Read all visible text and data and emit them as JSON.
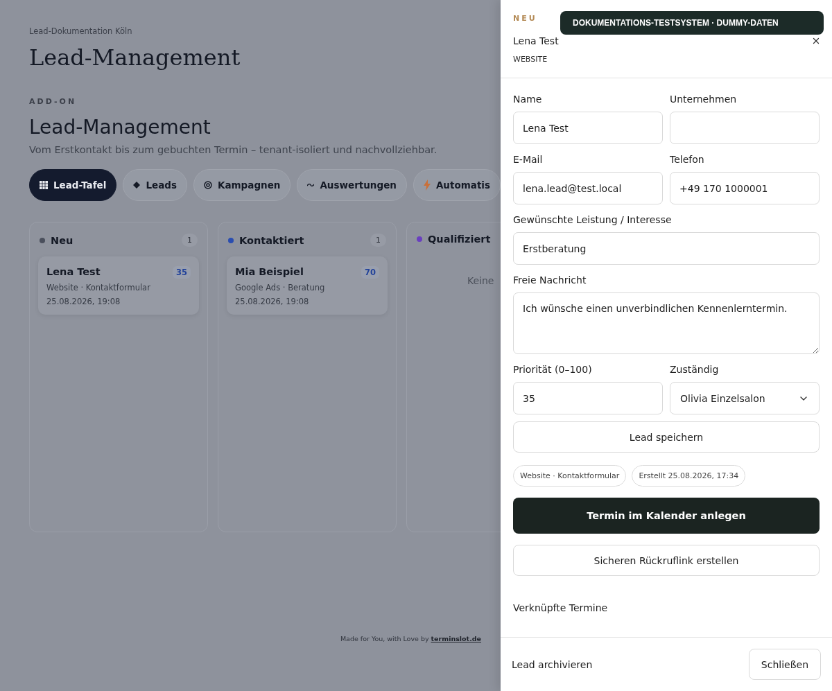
{
  "page": {
    "breadcrumb": "Lead-Dokumentation Köln",
    "title": "Lead-Management",
    "eyebrow": "ADD-ON",
    "heading": "Lead-Management",
    "subtitle": "Vom Erstkontakt bis zum gebuchten Termin – tenant-isoliert und nachvollziehbar.",
    "tabs": [
      {
        "label": "Lead-Tafel",
        "selected": true
      },
      {
        "label": "Leads",
        "selected": false
      },
      {
        "label": "Kampagnen",
        "selected": false
      },
      {
        "label": "Auswertungen",
        "selected": false
      },
      {
        "label": "Automatis",
        "selected": false
      }
    ],
    "columns": [
      {
        "title": "Neu",
        "color": "#4a4f5c",
        "count": "1",
        "cards": [
          {
            "name": "Lena Test",
            "score": "35",
            "source": "Website · Kontaktformular",
            "date": "25.08.2026, 19:08"
          }
        ]
      },
      {
        "title": "Kontaktiert",
        "color": "#2a4db0",
        "count": "1",
        "cards": [
          {
            "name": "Mia Beispiel",
            "score": "70",
            "source": "Google Ads · Beratung",
            "date": "25.08.2026, 19:08"
          }
        ]
      },
      {
        "title": "Qualifiziert",
        "color": "#6a3fc0",
        "empty": "Keine"
      }
    ],
    "footer": {
      "text": "Made for You, with Love by ",
      "link": "terminslot.de"
    }
  },
  "drawer": {
    "status": "NEU",
    "banner": "DOKUMENTATIONS-TESTSYSTEM · DUMMY-DATEN",
    "name": "Lena Test",
    "source": "WEBSITE",
    "fields": [
      {
        "label": "Name",
        "kind": "input",
        "value": "Lena Test"
      },
      {
        "label": "Unternehmen",
        "kind": "input"
      },
      {
        "label": "E-Mail",
        "kind": "input",
        "value": "lena.lead@test.local"
      },
      {
        "label": "Telefon",
        "kind": "input",
        "value": "+49 170 1000001"
      },
      {
        "label": "Gewünschte Leistung / Interesse",
        "kind": "wide-input",
        "value": "Erstberatung"
      },
      {
        "label": "Freie Nachricht",
        "kind": "textarea",
        "value": "Ich wünsche einen unverbindlichen Kennenlerntermin."
      },
      {
        "label": "Priorität (0–100)",
        "kind": "input",
        "value": "35"
      },
      {
        "label": "Zuständig",
        "kind": "select",
        "value": "Olivia Einzelsalon"
      }
    ],
    "save_button": "Lead speichern",
    "chips": [
      "Website · Kontaktformular",
      "Erstellt 25.08.2026, 17:34"
    ],
    "primary_button": "Termin im Kalender anlegen",
    "secondary_button": "Sicheren Rückruflink erstellen",
    "linked_title": "Verknüpfte Termine",
    "archive_link": "Lead archivieren",
    "close_button": "Schließen"
  }
}
